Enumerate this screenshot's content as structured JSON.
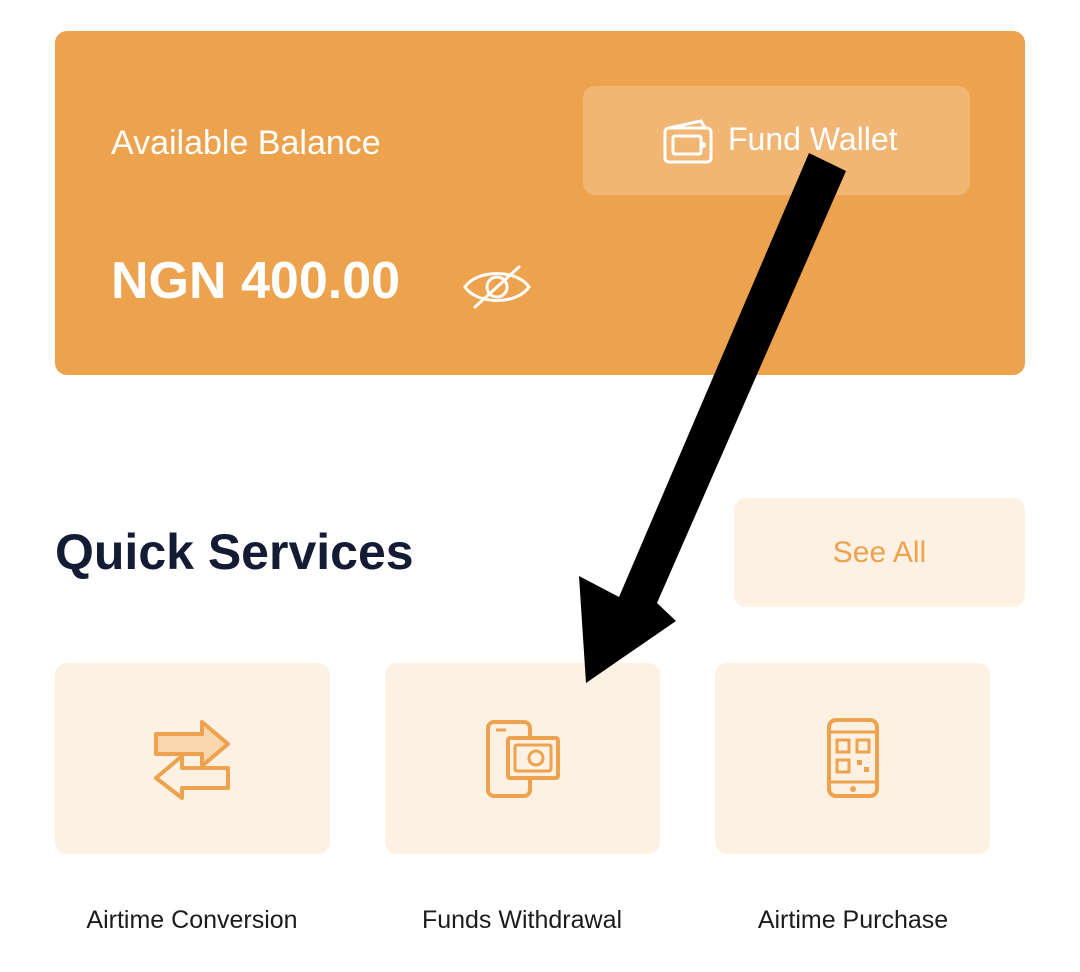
{
  "balance_card": {
    "label": "Available Balance",
    "amount": "NGN 400.00",
    "fund_wallet_label": "Fund Wallet",
    "icons": [
      "eye-slash-icon",
      "wallet-icon"
    ]
  },
  "quick_services": {
    "title": "Quick Services",
    "see_all_label": "See All",
    "items": [
      {
        "label": "Airtime Conversion",
        "icon": "exchange-arrows-icon"
      },
      {
        "label": "Funds Withdrawal",
        "icon": "phone-cash-icon"
      },
      {
        "label": "Airtime Purchase",
        "icon": "phone-qr-icon"
      }
    ]
  },
  "colors": {
    "accent": "#EDA24E",
    "tile_background": "#FDF1E3",
    "title_text": "#141B34",
    "annotation": "#000000"
  }
}
